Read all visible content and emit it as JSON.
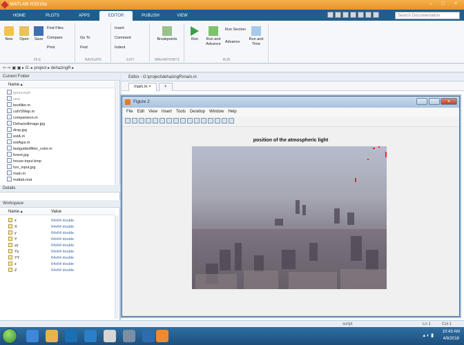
{
  "window": {
    "title": "MATLAB R2016a",
    "controls": "– □ ×"
  },
  "tabs": [
    {
      "label": "HOME"
    },
    {
      "label": "PLOTS"
    },
    {
      "label": "APPS"
    },
    {
      "label": "EDITOR"
    },
    {
      "label": "PUBLISH"
    },
    {
      "label": "VIEW"
    }
  ],
  "search": {
    "placeholder": "Search Documentation"
  },
  "toolstrip": {
    "new": "New",
    "open": "Open",
    "save": "Save",
    "find_files": "Find Files",
    "compare": "Compare",
    "print": "Print",
    "go_to": "Go To",
    "find": "Find",
    "insert": "Insert",
    "comment": "Comment",
    "indent": "Indent",
    "breakpoints": "Breakpoints",
    "run": "Run",
    "run_and_advance": "Run and Advance",
    "run_section": "Run Section",
    "advance": "Advance",
    "run_and_time": "Run and Time",
    "groups": {
      "file": "FILE",
      "navigate": "NAVIGATE",
      "edit": "EDIT",
      "breakpoints": "BREAKPOINTS",
      "run": "RUN"
    }
  },
  "address": {
    "path": "⇦ ⇨ ▣ ▣ ▸ G: ▸ project ▸ dehazingR ▸"
  },
  "current_folder": {
    "title": "Current Folder",
    "column": "Name ▴",
    "items": [
      {
        "name": "guimcmplt",
        "dim": true
      },
      {
        "name": "new",
        "dim": true
      },
      {
        "name": "boxfilter.m"
      },
      {
        "name": "calVSMap.m"
      },
      {
        "name": "comparision.m"
      },
      {
        "name": "DehazedImage.jpg"
      },
      {
        "name": "drop.jpg"
      },
      {
        "name": "estA.m"
      },
      {
        "name": "estAgui.m"
      },
      {
        "name": "fastguidedfilter_color.m"
      },
      {
        "name": "forest.jpg"
      },
      {
        "name": "house-input.bmp"
      },
      {
        "name": "hzv_input.jpg"
      },
      {
        "name": "main.m"
      },
      {
        "name": "matlab.mat"
      }
    ],
    "details": "Details"
  },
  "workspace": {
    "title": "Workspace",
    "col_name": "Name ▴",
    "col_value": "Value",
    "rows": [
      {
        "name": "x",
        "value": "64x64 double"
      },
      {
        "name": "X",
        "value": "64x64 double"
      },
      {
        "name": "y",
        "value": "64x64 double"
      },
      {
        "name": "Y",
        "value": "64x64 double"
      },
      {
        "name": "yy",
        "value": "64x64 double"
      },
      {
        "name": "Yy",
        "value": "64x64 double"
      },
      {
        "name": "YY",
        "value": "64x64 double"
      },
      {
        "name": "z",
        "value": "64x64 double"
      },
      {
        "name": "Z",
        "value": "64x64 double"
      }
    ]
  },
  "editor": {
    "header": "Editor - G:\\project\\dehazingR\\main.m",
    "tab": "main.m ×",
    "add_tab": "+"
  },
  "figure": {
    "title": "Figure 2",
    "menu": [
      "File",
      "Edit",
      "View",
      "Insert",
      "Tools",
      "Desktop",
      "Window",
      "Help"
    ],
    "plot_title": "position of the atmospheric light"
  },
  "status": {
    "script": "script",
    "ln": "Ln 1",
    "col": "Col 1"
  },
  "clock": {
    "time": "10:43 AM",
    "date": "4/8/2018"
  }
}
